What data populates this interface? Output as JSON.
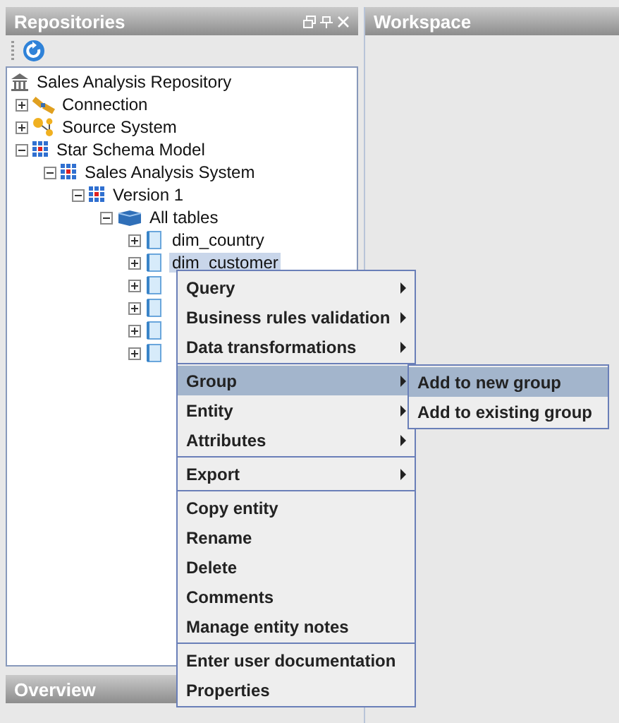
{
  "panels": {
    "repositories": {
      "title": "Repositories"
    },
    "workspace": {
      "title": "Workspace"
    },
    "overview": {
      "title": "Overview"
    }
  },
  "tree": [
    {
      "label": "Sales Analysis Repository",
      "kind": "repository",
      "selected": false,
      "children": [
        {
          "label": "Connection",
          "kind": "connection",
          "expanded": false,
          "selected": false
        },
        {
          "label": "Source System",
          "kind": "source",
          "expanded": false,
          "selected": false
        },
        {
          "label": "Star Schema Model",
          "kind": "model",
          "expanded": true,
          "selected": false,
          "children": [
            {
              "label": "Sales Analysis System",
              "kind": "model",
              "expanded": true,
              "selected": false,
              "children": [
                {
                  "label": "Version 1",
                  "kind": "model",
                  "expanded": true,
                  "selected": false,
                  "children": [
                    {
                      "label": "All tables",
                      "kind": "folder",
                      "expanded": true,
                      "selected": false,
                      "children": [
                        {
                          "label": "dim_country",
                          "kind": "table",
                          "expanded": false,
                          "selected": false
                        },
                        {
                          "label": "dim_customer",
                          "kind": "table",
                          "expanded": false,
                          "selected": true
                        },
                        {
                          "kind": "table",
                          "expanded": false
                        },
                        {
                          "kind": "table",
                          "expanded": false
                        },
                        {
                          "kind": "table",
                          "expanded": false
                        },
                        {
                          "kind": "table",
                          "expanded": false
                        }
                      ]
                    }
                  ]
                }
              ]
            }
          ]
        }
      ]
    }
  ],
  "context_menu": [
    [
      {
        "label": "Query",
        "submenu": true,
        "selected": false
      },
      {
        "label": "Business rules validation",
        "submenu": true,
        "selected": false
      },
      {
        "label": "Data transformations",
        "submenu": true,
        "selected": false
      }
    ],
    [
      {
        "label": "Group",
        "submenu": true,
        "selected": true
      },
      {
        "label": "Entity",
        "submenu": true,
        "selected": false
      },
      {
        "label": "Attributes",
        "submenu": true,
        "selected": false
      }
    ],
    [
      {
        "label": "Export",
        "submenu": true,
        "selected": false
      }
    ],
    [
      {
        "label": "Copy entity",
        "submenu": false,
        "selected": false
      },
      {
        "label": "Rename",
        "submenu": false,
        "selected": false
      },
      {
        "label": "Delete",
        "submenu": false,
        "selected": false
      },
      {
        "label": "Comments",
        "submenu": false,
        "selected": false
      },
      {
        "label": "Manage entity notes",
        "submenu": false,
        "selected": false
      }
    ],
    [
      {
        "label": "Enter user documentation",
        "submenu": false,
        "selected": false
      },
      {
        "label": "Properties",
        "submenu": false,
        "selected": false
      }
    ]
  ],
  "submenu": [
    {
      "label": "Add to new group",
      "selected": true
    },
    {
      "label": "Add to existing group",
      "selected": false
    }
  ]
}
